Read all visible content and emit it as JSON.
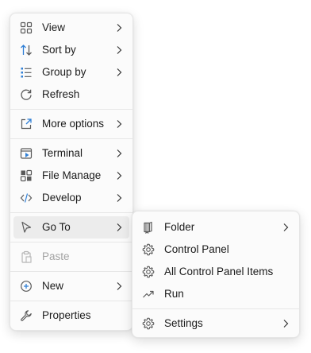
{
  "main_menu": {
    "items": [
      {
        "label": "View",
        "icon": "grid-view-icon",
        "has_submenu": true
      },
      {
        "label": "Sort by",
        "icon": "sort-arrows-icon",
        "has_submenu": true
      },
      {
        "label": "Group by",
        "icon": "group-list-icon",
        "has_submenu": true
      },
      {
        "label": "Refresh",
        "icon": "refresh-icon",
        "has_submenu": false
      },
      {
        "label": "More options",
        "icon": "open-external-icon",
        "has_submenu": true
      },
      {
        "label": "Terminal",
        "icon": "terminal-icon",
        "has_submenu": true
      },
      {
        "label": "File Manage",
        "icon": "file-manage-icon",
        "has_submenu": true
      },
      {
        "label": "Develop",
        "icon": "code-icon",
        "has_submenu": true
      },
      {
        "label": "Go To",
        "icon": "pointer-arrow-icon",
        "has_submenu": true,
        "highlighted": true
      },
      {
        "label": "Paste",
        "icon": "clipboard-icon",
        "has_submenu": false,
        "disabled": true
      },
      {
        "label": "New",
        "icon": "plus-circle-icon",
        "has_submenu": true
      },
      {
        "label": "Properties",
        "icon": "wrench-icon",
        "has_submenu": false
      }
    ]
  },
  "go_to_submenu": {
    "items": [
      {
        "label": "Folder",
        "icon": "bookmark-folder-icon",
        "has_submenu": true
      },
      {
        "label": "Control Panel",
        "icon": "gear-icon",
        "has_submenu": false
      },
      {
        "label": "All Control Panel Items",
        "icon": "gear-icon",
        "has_submenu": false
      },
      {
        "label": "Run",
        "icon": "trend-arrow-icon",
        "has_submenu": false
      },
      {
        "label": "Settings",
        "icon": "gear-icon",
        "has_submenu": true
      }
    ]
  },
  "colors": {
    "accent_blue": "#2f7fd6",
    "icon_gray": "#5a5a5a",
    "disabled_gray": "#a3a3a3",
    "hover_bg": "#ececec"
  }
}
